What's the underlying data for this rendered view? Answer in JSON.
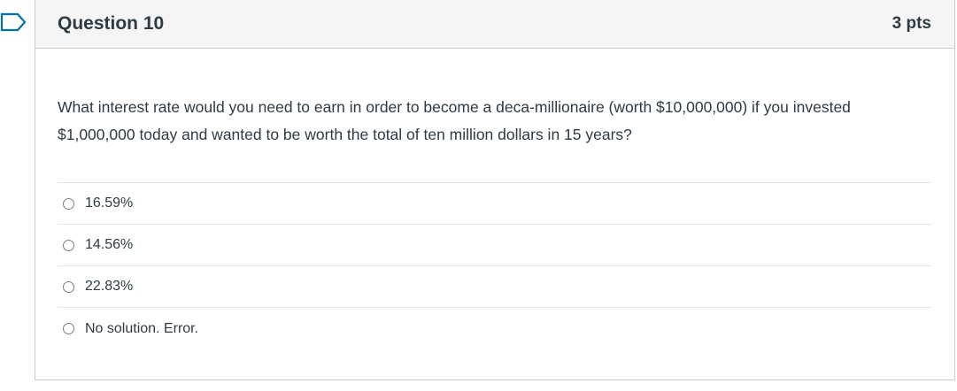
{
  "question": {
    "title": "Question 10",
    "points": "3 pts",
    "text": "What interest rate would you need to earn in order to become a deca-millionaire (worth $10,000,000) if you invested $1,000,000 today and wanted to be worth the total of ten million dollars in 15 years?",
    "answers": [
      {
        "label": "16.59%",
        "selected": false
      },
      {
        "label": "14.56%",
        "selected": false
      },
      {
        "label": "22.83%",
        "selected": false
      },
      {
        "label": "No solution.  Error.",
        "selected": false
      }
    ]
  },
  "colors": {
    "header_bg": "#f5f5f5",
    "text": "#2d3b45",
    "flag": "#0770a3",
    "border": "#c7cdd1"
  },
  "icons": {
    "flag": "flag-outline-icon",
    "radio": "radio-unchecked-icon"
  }
}
